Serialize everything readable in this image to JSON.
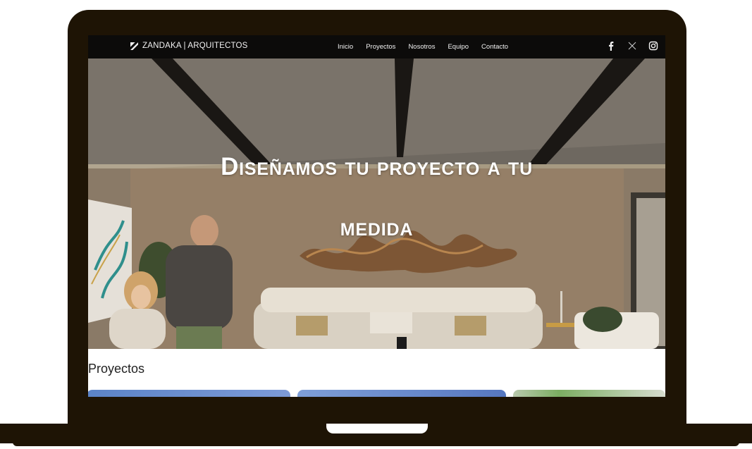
{
  "site": {
    "brand": "ZANDAKA | ARQUITECTOS",
    "nav": [
      "Inicio",
      "Proyectos",
      "Nosotros",
      "Equipo",
      "Contacto"
    ],
    "socials": [
      "facebook-icon",
      "x-icon",
      "instagram-icon"
    ]
  },
  "hero": {
    "title_line1": "Diseñamos tu proyecto a tu",
    "title_line2": "medida"
  },
  "projects": {
    "heading": "Proyectos"
  },
  "colors": {
    "frame": "#1e1405",
    "navbar": "#0c0b0a",
    "hero_text": "#ffffff"
  }
}
